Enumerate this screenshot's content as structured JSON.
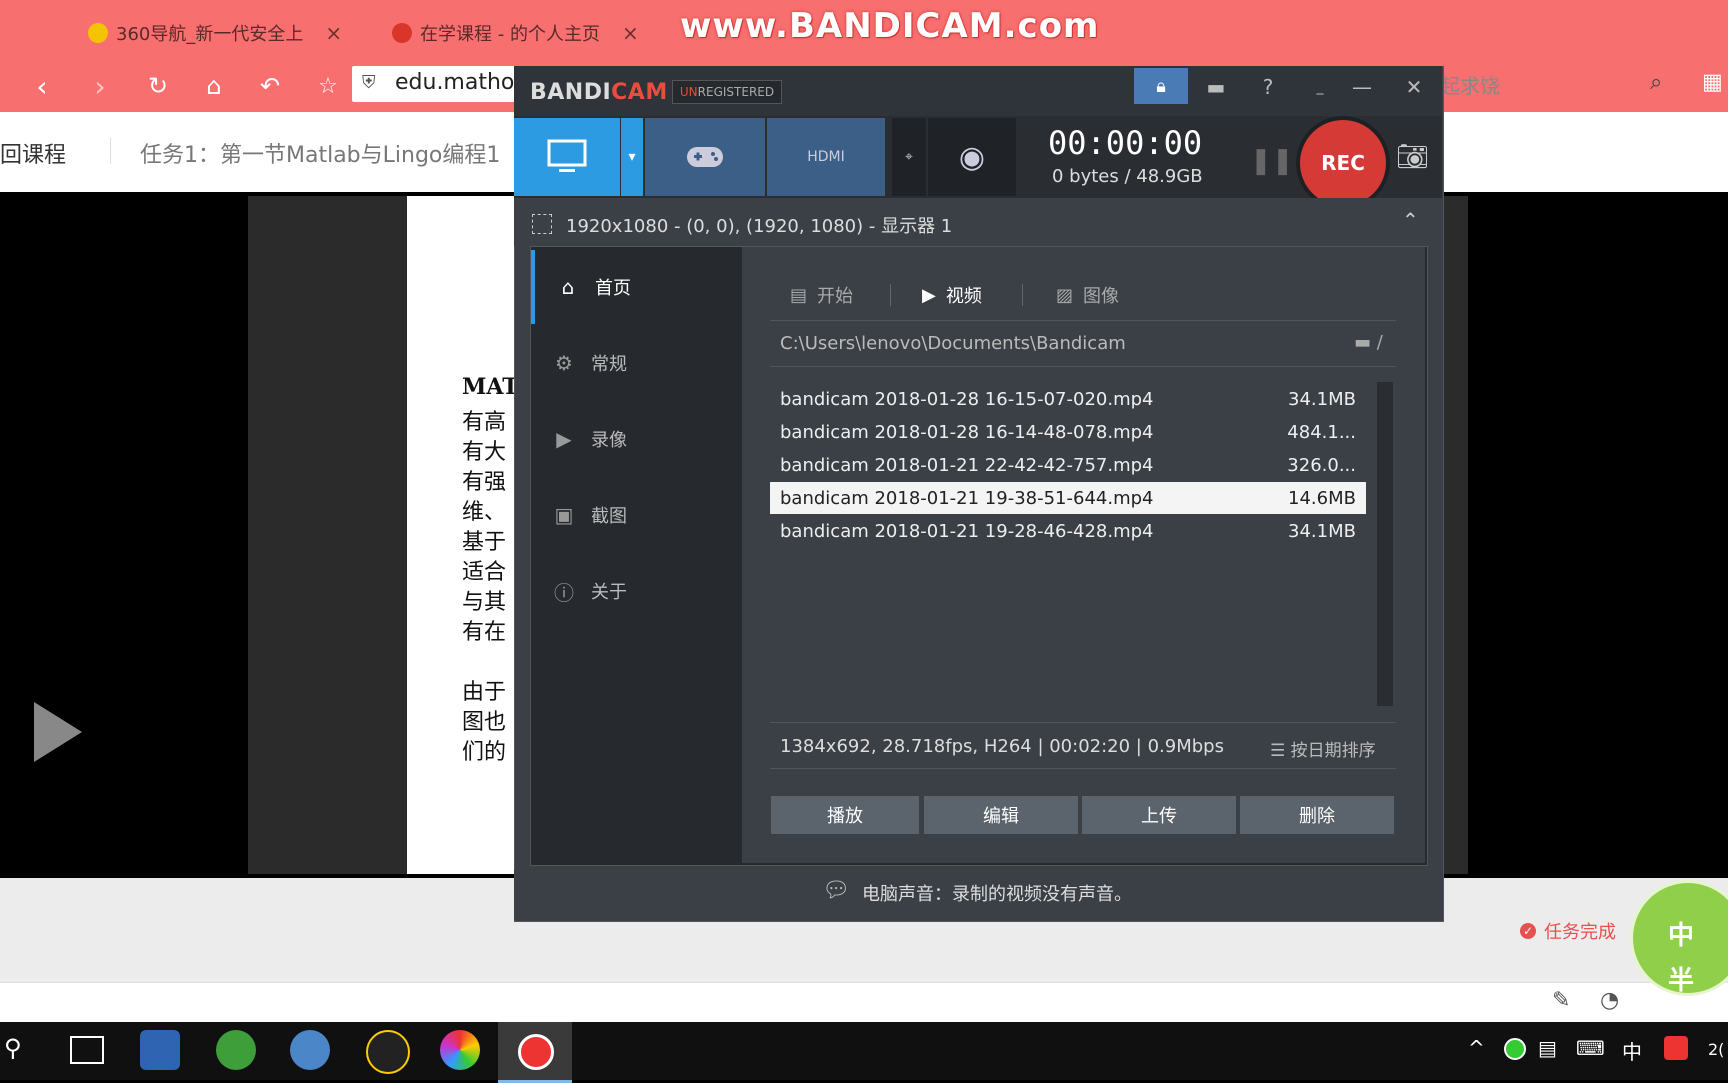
{
  "browser": {
    "tabs": [
      {
        "label": "360导航_新一代安全上",
        "close": "×"
      },
      {
        "label": "在学课程 - 的个人主页",
        "close": "×"
      }
    ],
    "watermark": "www.BANDICAM.com",
    "address": "edu.mathor",
    "search_fragment": "起求饶"
  },
  "page": {
    "back_label": "回课程",
    "task_title": "任务1：第一节Matlab与Lingo编程1",
    "doc_lines": [
      "MAT",
      "有高",
      "有大",
      "有强",
      "维、",
      "基于",
      "适合",
      "与其",
      "有在",
      "由于",
      "图也",
      "们的"
    ],
    "task_done": "任务完成",
    "apple_text1": "中",
    "apple_text2": "半"
  },
  "bandicam": {
    "logo_a": "BANDI",
    "logo_b": "CAM",
    "unreg_a": "UN",
    "unreg_b": "REGISTERED",
    "help": "?",
    "minimize_small": "_",
    "minimize": "—",
    "close": "✕",
    "timer": "00:00:00",
    "bytes": "0 bytes / 48.9GB",
    "rec": "REC",
    "hdmi": "HDMI",
    "region": "1920x1080 - (0, 0), (1920, 1080) - 显示器 1",
    "sidebar": [
      {
        "label": "首页",
        "icon": "home-icon"
      },
      {
        "label": "常规",
        "icon": "gear-icon"
      },
      {
        "label": "录像",
        "icon": "video-settings-icon"
      },
      {
        "label": "截图",
        "icon": "image-settings-icon"
      },
      {
        "label": "关于",
        "icon": "info-icon"
      }
    ],
    "subtabs": [
      "开始",
      "视频",
      "图像"
    ],
    "path": "C:\\Users\\lenovo\\Documents\\Bandicam",
    "path_slash": "/",
    "files": [
      {
        "name": "bandicam 2018-01-28 16-15-07-020.mp4",
        "size": "34.1MB"
      },
      {
        "name": "bandicam 2018-01-28 16-14-48-078.mp4",
        "size": "484.1..."
      },
      {
        "name": "bandicam 2018-01-21 22-42-42-757.mp4",
        "size": "326.0..."
      },
      {
        "name": "bandicam 2018-01-21 19-38-51-644.mp4",
        "size": "14.6MB"
      },
      {
        "name": "bandicam 2018-01-21 19-28-46-428.mp4",
        "size": "34.1MB"
      }
    ],
    "info": "1384x692, 28.718fps, H264 | 00:02:20 | 0.9Mbps",
    "sort": "按日期排序",
    "actions": [
      "播放",
      "编辑",
      "上传",
      "删除"
    ],
    "footer": "电脑声音：录制的视频没有声音。"
  },
  "taskbar": {
    "tray_ime": "中",
    "clock_fragment": "2("
  },
  "colors": {
    "browser_accent": "#f86f6f",
    "bandicam_blue": "#2d9be2",
    "rec_red": "#d63a36"
  }
}
